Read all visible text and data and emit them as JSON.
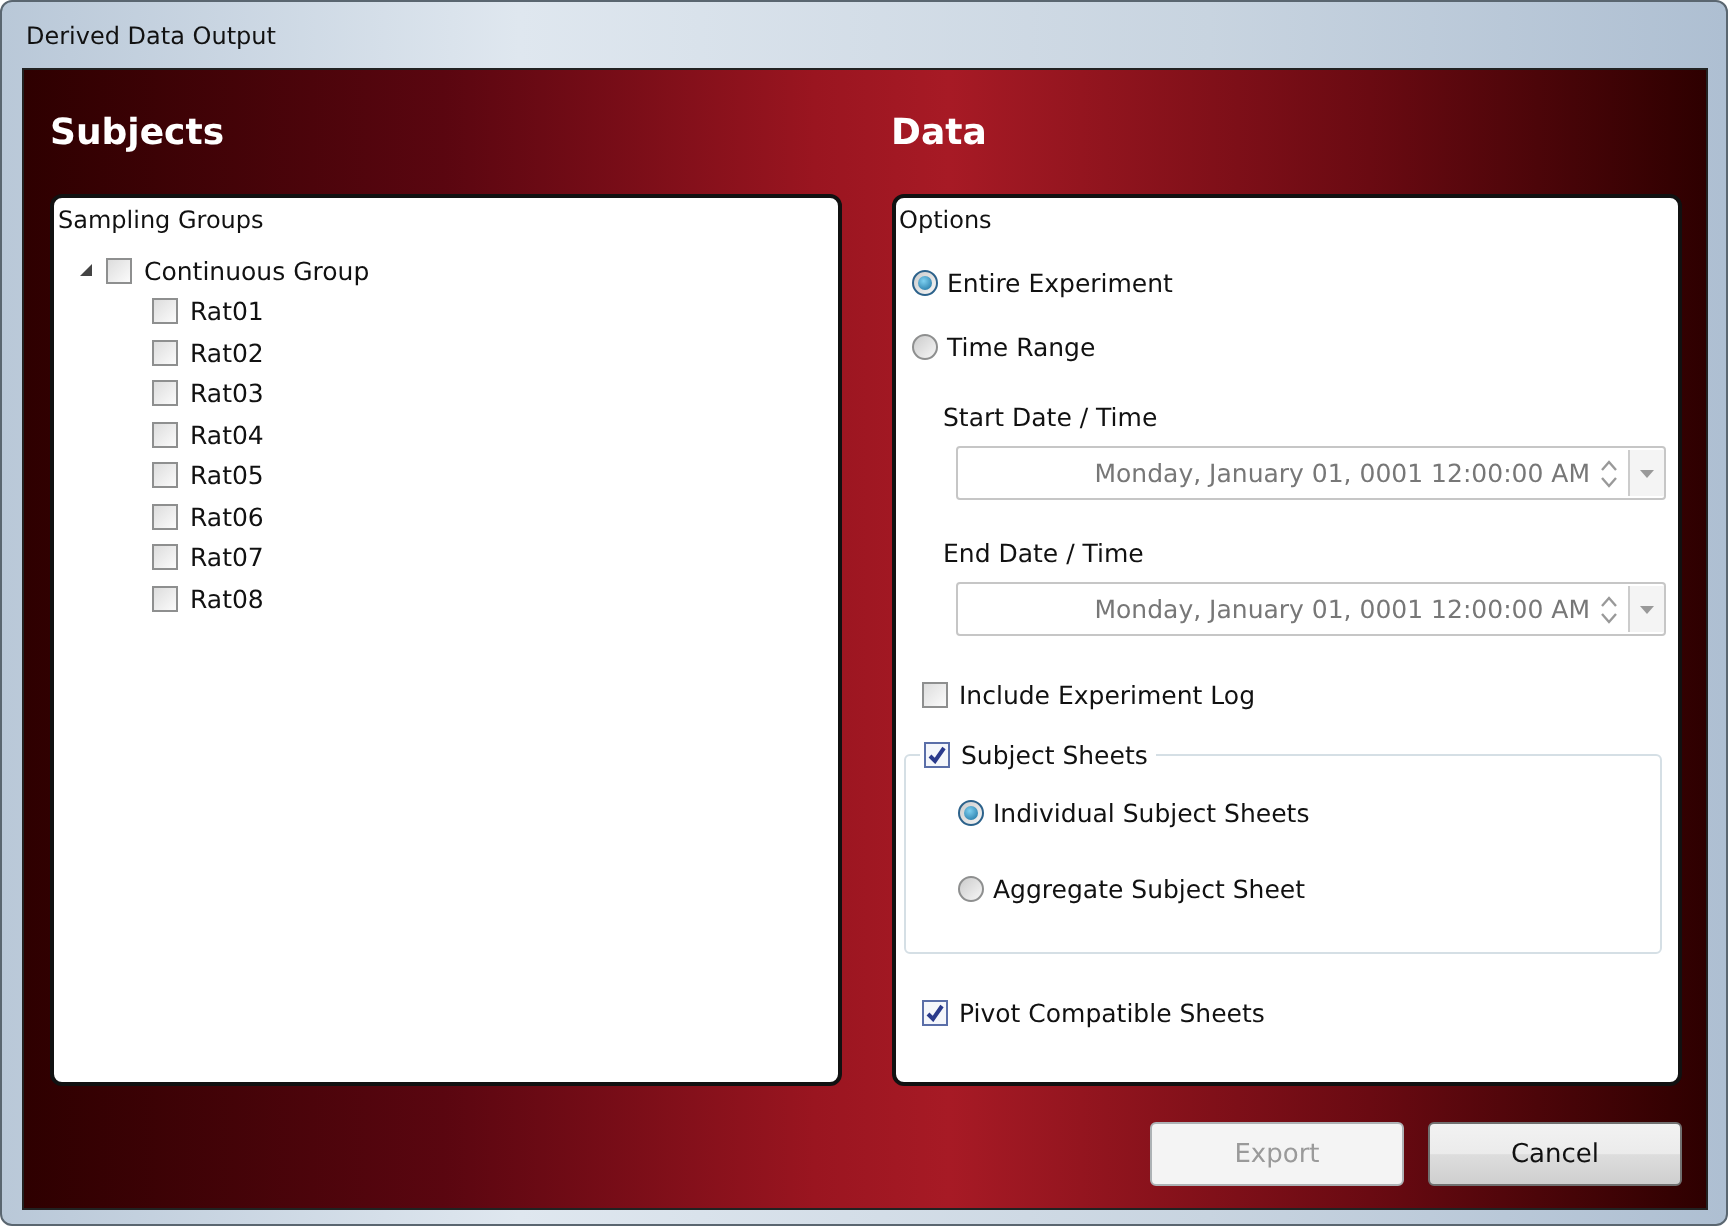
{
  "window": {
    "title": "Derived Data Output"
  },
  "subjects": {
    "heading": "Subjects",
    "panel_title": "Sampling Groups",
    "tree": {
      "label": "Continuous Group",
      "expanded": true,
      "checked": false,
      "children": [
        {
          "label": "Rat01",
          "checked": false
        },
        {
          "label": "Rat02",
          "checked": false
        },
        {
          "label": "Rat03",
          "checked": false
        },
        {
          "label": "Rat04",
          "checked": false
        },
        {
          "label": "Rat05",
          "checked": false
        },
        {
          "label": "Rat06",
          "checked": false
        },
        {
          "label": "Rat07",
          "checked": false
        },
        {
          "label": "Rat08",
          "checked": false
        }
      ]
    }
  },
  "data": {
    "heading": "Data",
    "panel_title": "Options",
    "range_options": [
      {
        "label": "Entire Experiment",
        "selected": true
      },
      {
        "label": "Time Range",
        "selected": false
      }
    ],
    "date_fields": [
      {
        "label": "Start Date / Time",
        "value": "Monday, January 01, 0001 12:00:00 AM",
        "disabled": true
      },
      {
        "label": "End Date / Time",
        "value": "Monday, January 01, 0001 12:00:00 AM",
        "disabled": true
      }
    ],
    "include_log": {
      "label": "Include Experiment Log",
      "checked": false
    },
    "subject_sheets": {
      "label": "Subject Sheets",
      "checked": true,
      "options": [
        {
          "label": "Individual Subject Sheets",
          "selected": true
        },
        {
          "label": "Aggregate Subject Sheet",
          "selected": false
        }
      ]
    },
    "pivot": {
      "label": "Pivot Compatible Sheets",
      "checked": true
    }
  },
  "buttons": [
    {
      "label": "Export",
      "disabled": true
    },
    {
      "label": "Cancel",
      "disabled": false
    }
  ]
}
